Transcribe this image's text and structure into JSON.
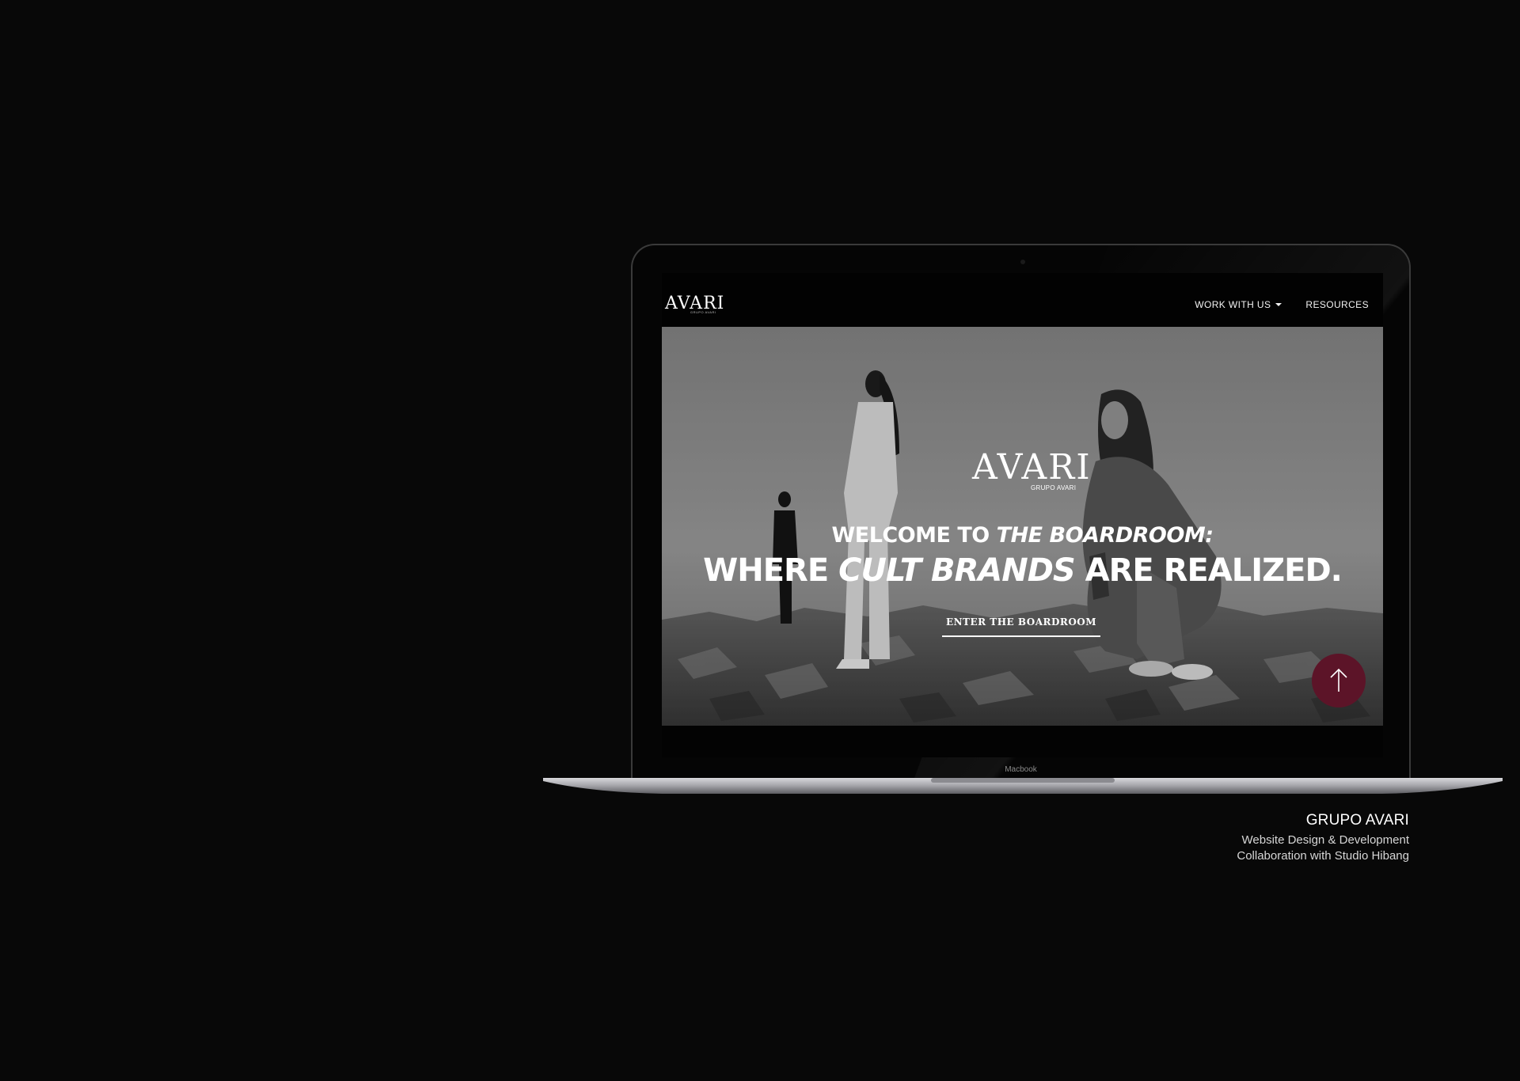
{
  "laptop": {
    "model_label": "Macbook"
  },
  "site": {
    "header": {
      "logo_text": "AVARI",
      "logo_sub": "GRUPO AVARI",
      "nav": [
        {
          "label": "WORK WITH US",
          "has_dropdown": true
        },
        {
          "label": "RESOURCES",
          "has_dropdown": false
        }
      ]
    },
    "hero": {
      "logo_text": "AVARI",
      "logo_sub": "GRUPO AVARI",
      "line1_plain": "WELCOME TO ",
      "line1_italic": "THE BOARDROOM:",
      "line2_plain_a": "WHERE ",
      "line2_italic": "CULT BRANDS",
      "line2_plain_b": " ARE REALIZED.",
      "cta_label": "ENTER THE BOARDROOM",
      "scroll_top_icon": "arrow-up-icon"
    }
  },
  "caption": {
    "title": "GRUPO AVARI",
    "line1": "Website Design & Development",
    "line2": "Collaboration with Studio Hibang"
  },
  "colors": {
    "page_background": "#080808",
    "accent": "#5c1428",
    "text": "#ffffff"
  }
}
